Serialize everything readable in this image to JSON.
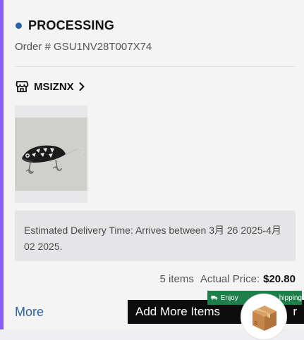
{
  "order": {
    "status": "PROCESSING",
    "number_text": "Order # GSU1NV28T007X74",
    "status_color": "#2a62a8"
  },
  "store": {
    "name": "MSIZNX",
    "icon": "store-icon"
  },
  "delivery": {
    "text": "Estimated Delivery Time: Arrives between 3月 26 2025-4月 02 2025."
  },
  "summary": {
    "items": "5 items",
    "price_label": "Actual Price:",
    "price": "$20.80"
  },
  "actions": {
    "more": "More",
    "add_more_prefix": "Add More Items",
    "add_more_suffix": "r"
  },
  "promo": {
    "text_visible": "Enjoy",
    "text_tail": "hipping"
  },
  "colors": {
    "accent_left": "#8a5cf6",
    "link": "#2a62a8",
    "promo_bg": "#1e7f4a"
  }
}
